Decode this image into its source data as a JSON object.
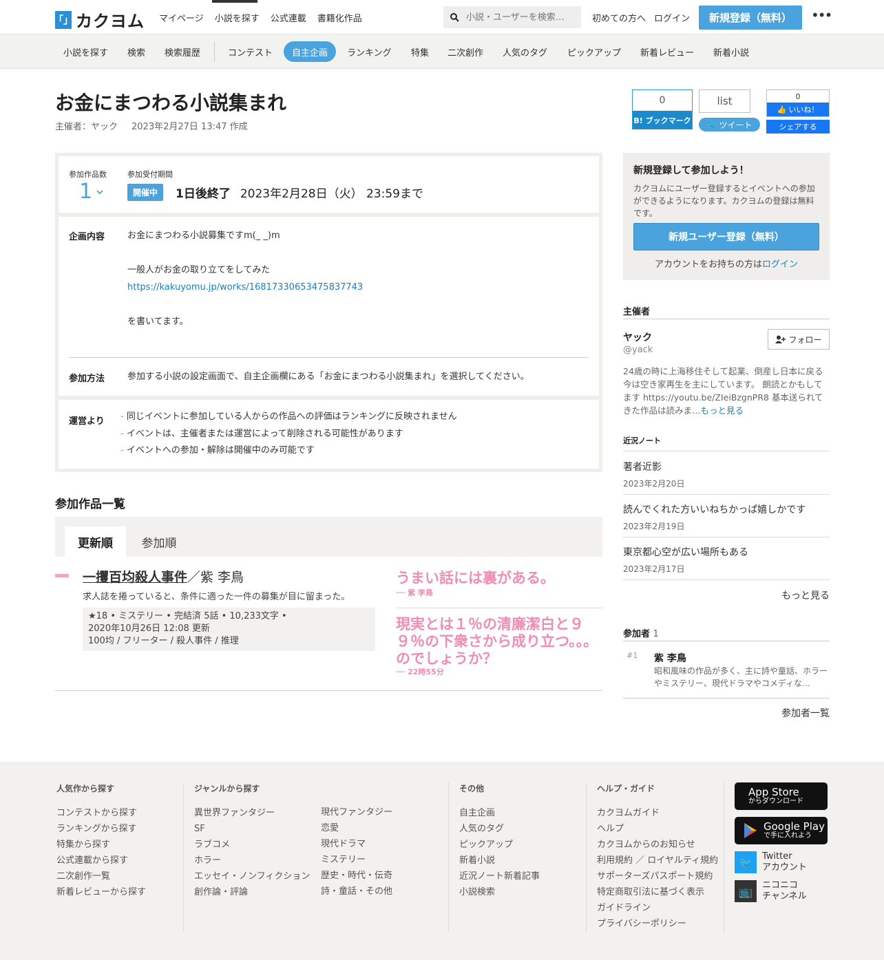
{
  "header": {
    "logo_mark": "「」",
    "logo_text": "カクヨム",
    "nav": [
      "マイページ",
      "小説を探す",
      "公式連載",
      "書籍化作品"
    ],
    "search_placeholder": "小説・ユーザーを検索…",
    "first_time": "初めての方へ",
    "login": "ログイン",
    "signup": "新規登録（無料）",
    "more": "•••"
  },
  "subnav": [
    "小説を探す",
    "検索",
    "検索履歴",
    "コンテスト",
    "自主企画",
    "ランキング",
    "特集",
    "二次創作",
    "人気のタグ",
    "ピックアップ",
    "新着レビュー",
    "新着小説"
  ],
  "event": {
    "title": "お金にまつわる小説集まれ",
    "organizer_label": "主催者：ヤック",
    "created": "2023年2月27日 13:47 作成",
    "participants_label": "参加作品数",
    "participants_count": "1",
    "period_label": "参加受付期間",
    "status": "開催中",
    "ends_in": "1日後終了",
    "deadline": "2023年2月28日（火） 23:59まで",
    "content_label": "企画内容",
    "content_lines": [
      "お金にまつわる小説募集ですm(_ _)m",
      "",
      "一般人がお金の取り立てをしてみた",
      "https://kakuyomu.jp/works/16817330653475837743",
      "",
      "を書いてます。"
    ],
    "method_label": "参加方法",
    "method_text": "参加する小説の設定画面で、自主企画欄にある「お金にまつわる小説集まれ」を選択してください。",
    "notice_label": "運営より",
    "notices": [
      "同じイベントに参加している人からの作品への評価はランキングに反映されません",
      "イベントは、主催者または運営によって削除される可能性があります",
      "イベントへの参加・解除は開催中のみ可能です"
    ]
  },
  "share": {
    "hatena_count": "0",
    "hatena_label": "B! ブックマーク",
    "list_label": "list",
    "tweet_label": "ツイート",
    "fb_count": "0",
    "fb_like": "いいね！",
    "fb_share": "シェアする"
  },
  "works": {
    "section_title": "参加作品一覧",
    "tab_updated": "更新順",
    "tab_joined": "参加順",
    "items": [
      {
        "title": "一攫百均殺人事件",
        "author": "／紫 李鳥",
        "desc": "求人誌を捲っていると、条件に適った一件の募集が目に留まった。",
        "stats": "★18 • ミステリー • 完結済 5話 • 10,233文字 •",
        "updated": "2020年10月26日 12:08 更新",
        "tags": "100均 / フリーター / 殺人事件 / 推理",
        "catch1": "うまい話には裏がある。",
        "catch1_by": "── 紫 李鳥",
        "catch2": "現実とは１％の清廉潔白と９９％の下衆さから成り立つ。。。のでしょうか？",
        "catch2_by": "── 22時55分"
      }
    ]
  },
  "sidebar": {
    "signup_title": "新規登録して参加しよう！",
    "signup_text": "カクヨムにユーザー登録するとイベントへの参加ができるようになります。カクヨムの登録は無料です。",
    "signup_button": "新規ユーザー登録（無料）",
    "login_prefix": "アカウントをお持ちの方は",
    "login_link": "ログイン",
    "organizer_heading": "主催者",
    "organizer_name": "ヤック",
    "organizer_id": "@yack",
    "follow": "フォロー",
    "organizer_bio": "24歳の時に上海移住そして起業、倒産し日本に戻る今は空き家再生を主にしています。 朗読とかもしてます https://youtu.be/ZIeiBzgnPR8 基本送られてきた作品は読みま…",
    "bio_more": "もっと見る",
    "notes_heading": "近況ノート",
    "notes": [
      {
        "title": "著者近影",
        "date": "2023年2月20日"
      },
      {
        "title": "読んでくれた方いいねちかっぱ嬉しかです",
        "date": "2023年2月19日"
      },
      {
        "title": "東京都心空が広い場所もある",
        "date": "2023年2月17日"
      }
    ],
    "notes_more": "もっと見る",
    "participants_heading": "参加者",
    "participants_count": "1",
    "participant_rank": "#1",
    "participant_name": "紫 李鳥",
    "participant_bio": "昭和風味の作品が多く、主に詩や童話、ホラーやミステリー、現代ドラマやコメディな…",
    "participants_more": "参加者一覧"
  },
  "footer": {
    "col1_title": "人気作から探す",
    "col1": [
      "コンテストから探す",
      "ランキングから探す",
      "特集から探す",
      "公式連載から探す",
      "二次創作一覧",
      "新着レビューから探す"
    ],
    "col2_title": "ジャンルから探す",
    "col2a": [
      "異世界ファンタジー",
      "SF",
      "ラブコメ",
      "ホラー",
      "エッセイ・ノンフィクション",
      "創作論・評論"
    ],
    "col2b": [
      "現代ファンタジー",
      "恋愛",
      "現代ドラマ",
      "ミステリー",
      "歴史・時代・伝奇",
      "詩・童話・その他"
    ],
    "col3_title": "その他",
    "col3": [
      "自主企画",
      "人気のタグ",
      "ピックアップ",
      "新着小説",
      "近況ノート新着記事",
      "小説検索"
    ],
    "col4_title": "ヘルプ・ガイド",
    "col4": [
      "カクヨムガイド",
      "ヘルプ",
      "カクヨムからのお知らせ",
      "利用規約 ／ ロイヤルティ規約",
      "サポーターズパスポート規約",
      "特定商取引法に基づく表示",
      "ガイドライン",
      "プライバシーポリシー"
    ],
    "appstore_big": "App Store",
    "appstore_small": "からダウンロード",
    "googleplay_big": "Google Play",
    "googleplay_small": "で手に入れよう",
    "twitter_line1": "Twitter",
    "twitter_line2": "アカウント",
    "nico_line1": "ニコニコ",
    "nico_line2": "チャンネル"
  }
}
